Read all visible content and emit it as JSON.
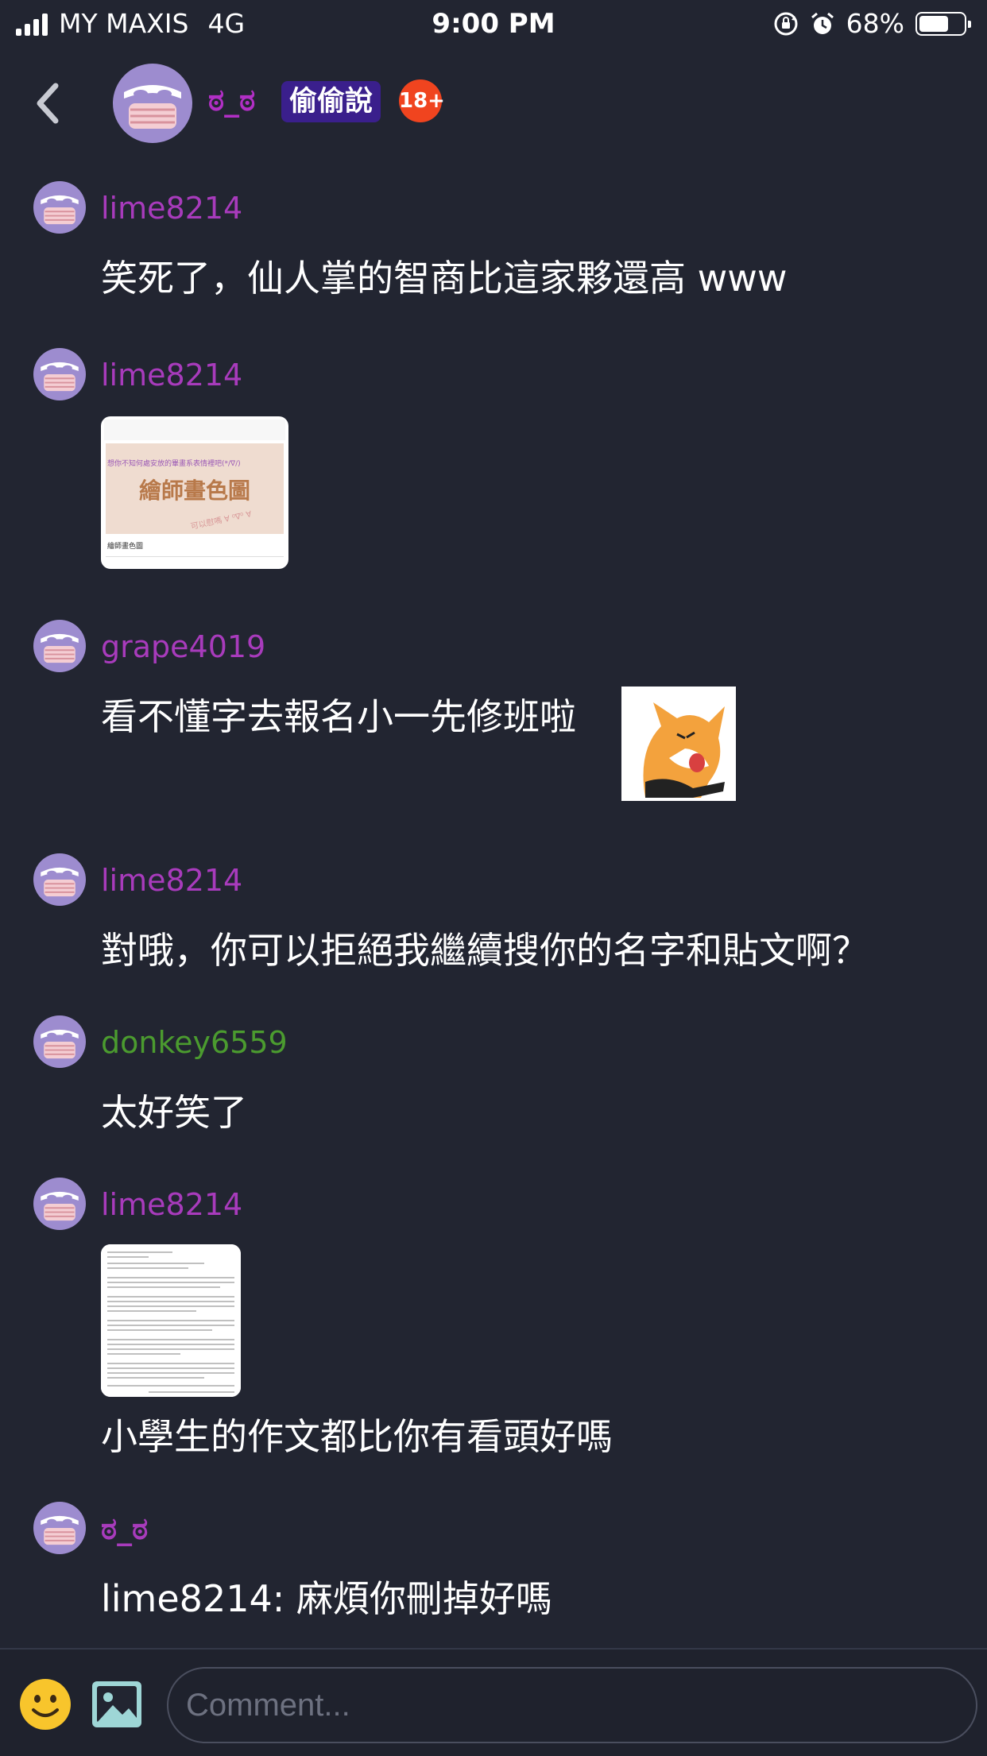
{
  "status_bar": {
    "carrier": "MY MAXIS",
    "network": "4G",
    "time": "9:00 PM",
    "battery": "68%",
    "battery_level": 0.68
  },
  "header": {
    "username": "ಠ_ಠ",
    "topic": "偷偷說",
    "age_badge": "18+"
  },
  "messages": [
    {
      "username": "lime8214",
      "text": "笑死了，仙人掌的智商比這家夥還高 www"
    },
    {
      "username": "lime8214",
      "image": {
        "top_text": "想你不知何處安放的畢畫系表情裡吧(*/∇/)",
        "title": "繪師畫色圖",
        "stamp": "可以慰嗎 ∀ ⁰∇⁰ ∀",
        "caption": "繪師畫色圖"
      }
    },
    {
      "username": "grape4019",
      "text": "看不懂字去報名小一先修班啦"
    },
    {
      "username": "lime8214",
      "text": "對哦，你可以拒絕我繼續搜你的名字和貼文啊？"
    },
    {
      "username": "donkey6559",
      "text": "太好笑了"
    },
    {
      "username": "lime8214",
      "text": "小學生的作文都比你有看頭好嗎"
    },
    {
      "username": "ಠ_ಠ",
      "text": "lime8214: 麻煩你刪掉好嗎"
    }
  ],
  "composer": {
    "placeholder": "Comment..."
  }
}
